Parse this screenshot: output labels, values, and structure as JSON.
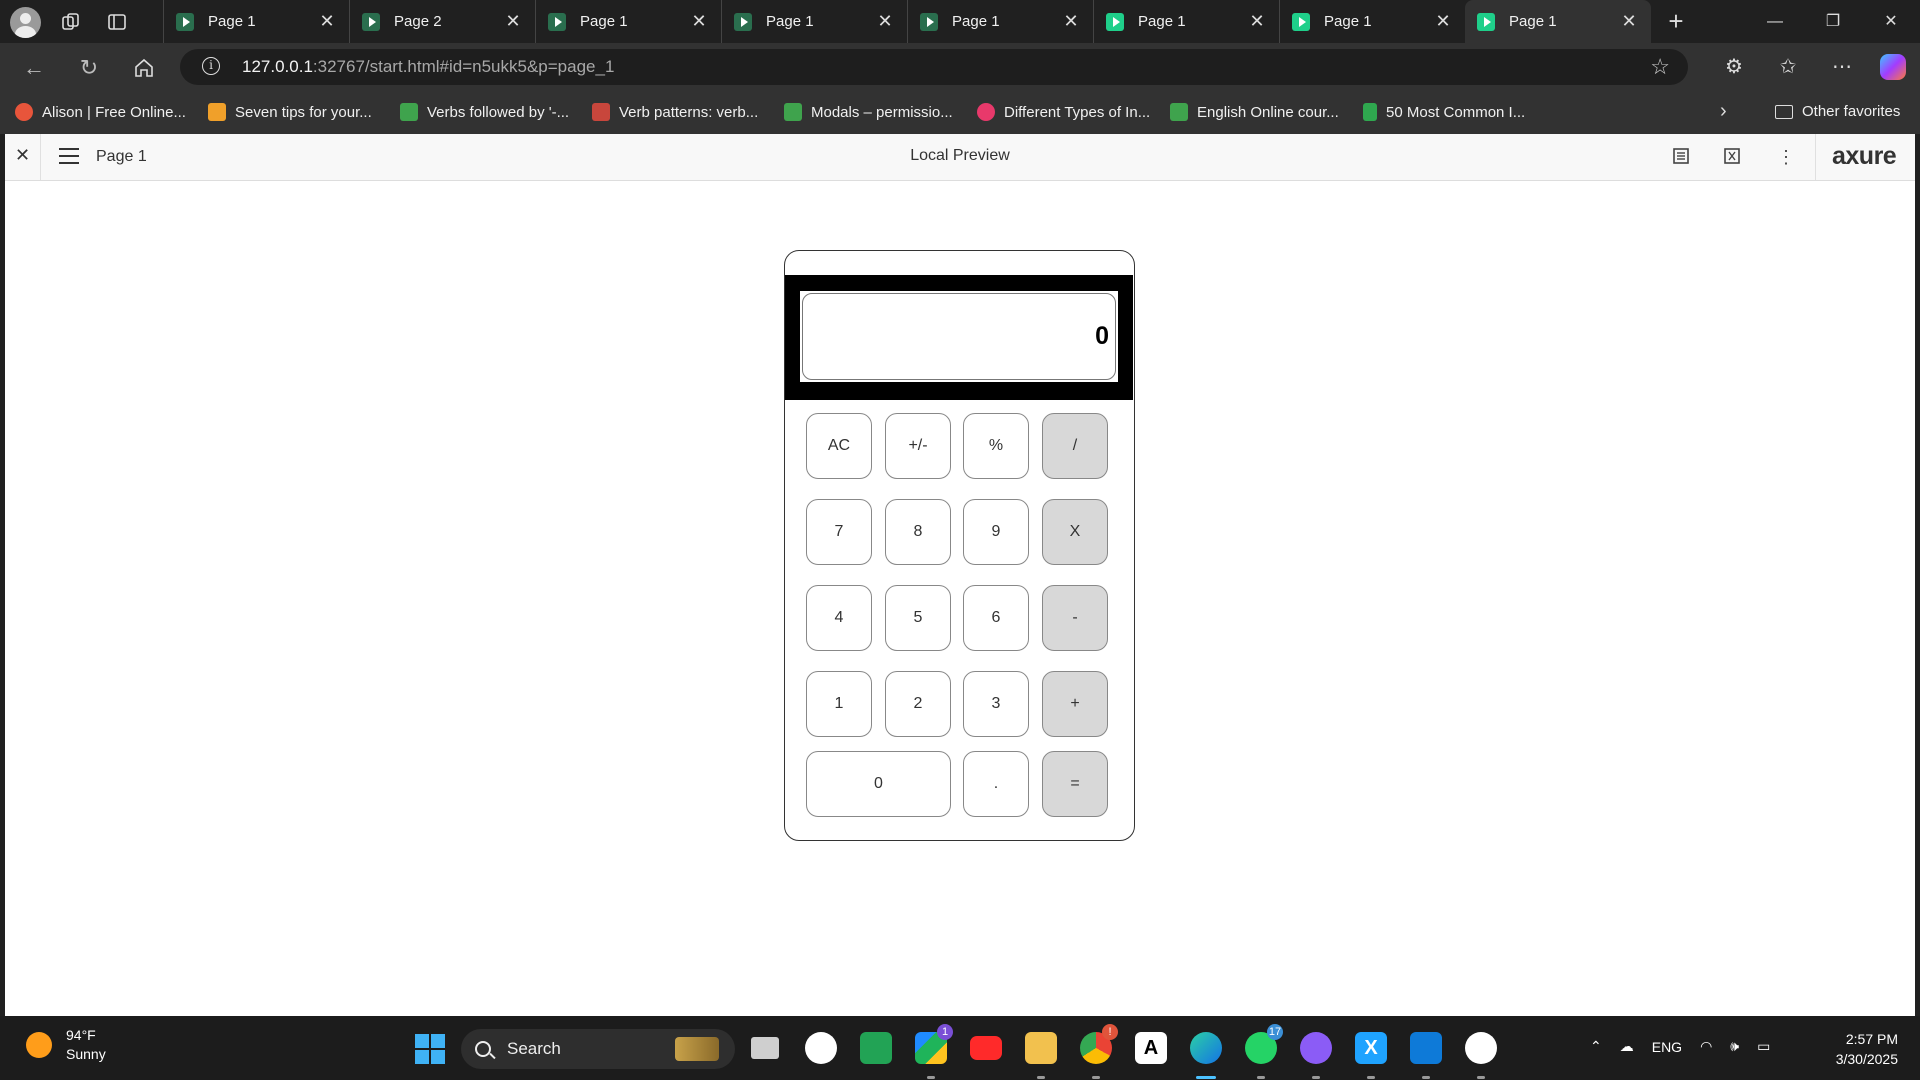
{
  "browser": {
    "tabs": [
      {
        "title": "Page 1",
        "active": false
      },
      {
        "title": "Page 2",
        "active": false
      },
      {
        "title": "Page 1",
        "active": false
      },
      {
        "title": "Page 1",
        "active": false
      },
      {
        "title": "Page 1",
        "active": false
      },
      {
        "title": "Page 1",
        "active": false
      },
      {
        "title": "Page 1",
        "active": false
      },
      {
        "title": "Page 1",
        "active": true
      }
    ],
    "url_host": "127.0.0.1",
    "url_rest": ":32767/start.html#id=n5ukk5&p=page_1",
    "favorites": [
      {
        "label": "Alison | Free Online...",
        "color": "#e8553b"
      },
      {
        "label": "Seven tips for your...",
        "color": "#f0a02a"
      },
      {
        "label": "Verbs followed by '-...",
        "color": "#3fa34d"
      },
      {
        "label": "Verb patterns: verb...",
        "color": "#c8463c"
      },
      {
        "label": "Modals – permissio...",
        "color": "#3fa34d"
      },
      {
        "label": "Different Types of In...",
        "color": "#e8396b"
      },
      {
        "label": "English Online cour...",
        "color": "#3fa34d"
      },
      {
        "label": "50 Most Common I...",
        "color": "#2fa84f"
      }
    ],
    "other_favorites": "Other favorites"
  },
  "axure": {
    "page_name": "Page 1",
    "title": "Local Preview",
    "logo": "axure"
  },
  "calculator": {
    "display": "0",
    "keys": {
      "ac": "AC",
      "sign": "+/-",
      "percent": "%",
      "divide": "/",
      "seven": "7",
      "eight": "8",
      "nine": "9",
      "multiply": "X",
      "four": "4",
      "five": "5",
      "six": "6",
      "minus": "-",
      "one": "1",
      "two": "2",
      "three": "3",
      "plus": "+",
      "zero": "0",
      "dot": ".",
      "equals": "="
    }
  },
  "taskbar": {
    "temperature": "94°F",
    "condition": "Sunny",
    "search_label": "Search",
    "language": "ENG",
    "time": "2:57 PM",
    "date": "3/30/2025",
    "badges": {
      "drive": "1",
      "chrome": "!",
      "whatsapp": "17"
    }
  },
  "colors": {
    "accent": "#4cc2ff",
    "operator_key": "#d8d8d8",
    "display_frame": "#000000"
  }
}
